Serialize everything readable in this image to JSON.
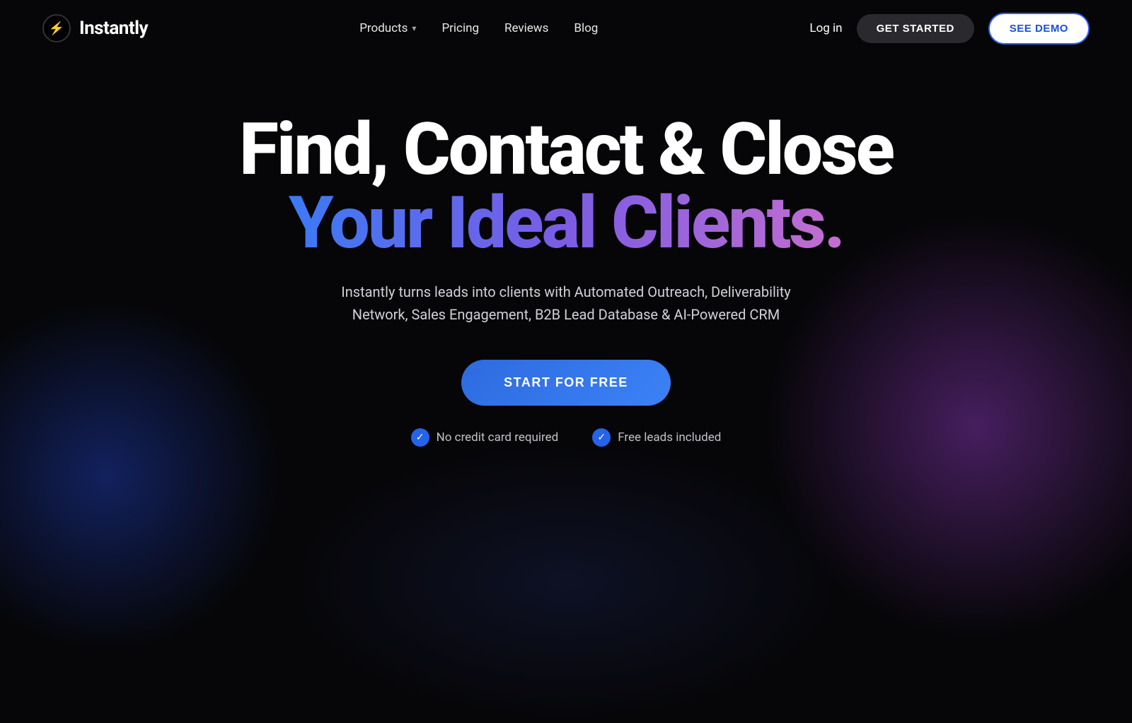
{
  "nav": {
    "logo_text": "Instantly",
    "logo_icon": "⚡",
    "links": [
      {
        "label": "Products",
        "has_dropdown": true
      },
      {
        "label": "Pricing",
        "has_dropdown": false
      },
      {
        "label": "Reviews",
        "has_dropdown": false
      },
      {
        "label": "Blog",
        "has_dropdown": false
      }
    ],
    "login_label": "Log in",
    "cta_get_started": "GET STARTED",
    "cta_see_demo": "SEE DEMO"
  },
  "hero": {
    "title_line1": "Find, Contact & Close",
    "title_line2": "Your Ideal Clients.",
    "subtitle": "Instantly turns leads into clients with Automated Outreach, Deliverability Network, Sales Engagement, B2B Lead Database & AI-Powered CRM",
    "cta_button": "START FOR FREE",
    "trust_badges": [
      {
        "icon": "✓",
        "label": "No credit card required"
      },
      {
        "icon": "✓",
        "label": "Free leads included"
      }
    ]
  },
  "colors": {
    "bg": "#060608",
    "accent_blue": "#2563eb",
    "accent_purple": "#7c5ce4",
    "gradient_start": "#3b7af5",
    "gradient_end": "#c46ed0"
  }
}
